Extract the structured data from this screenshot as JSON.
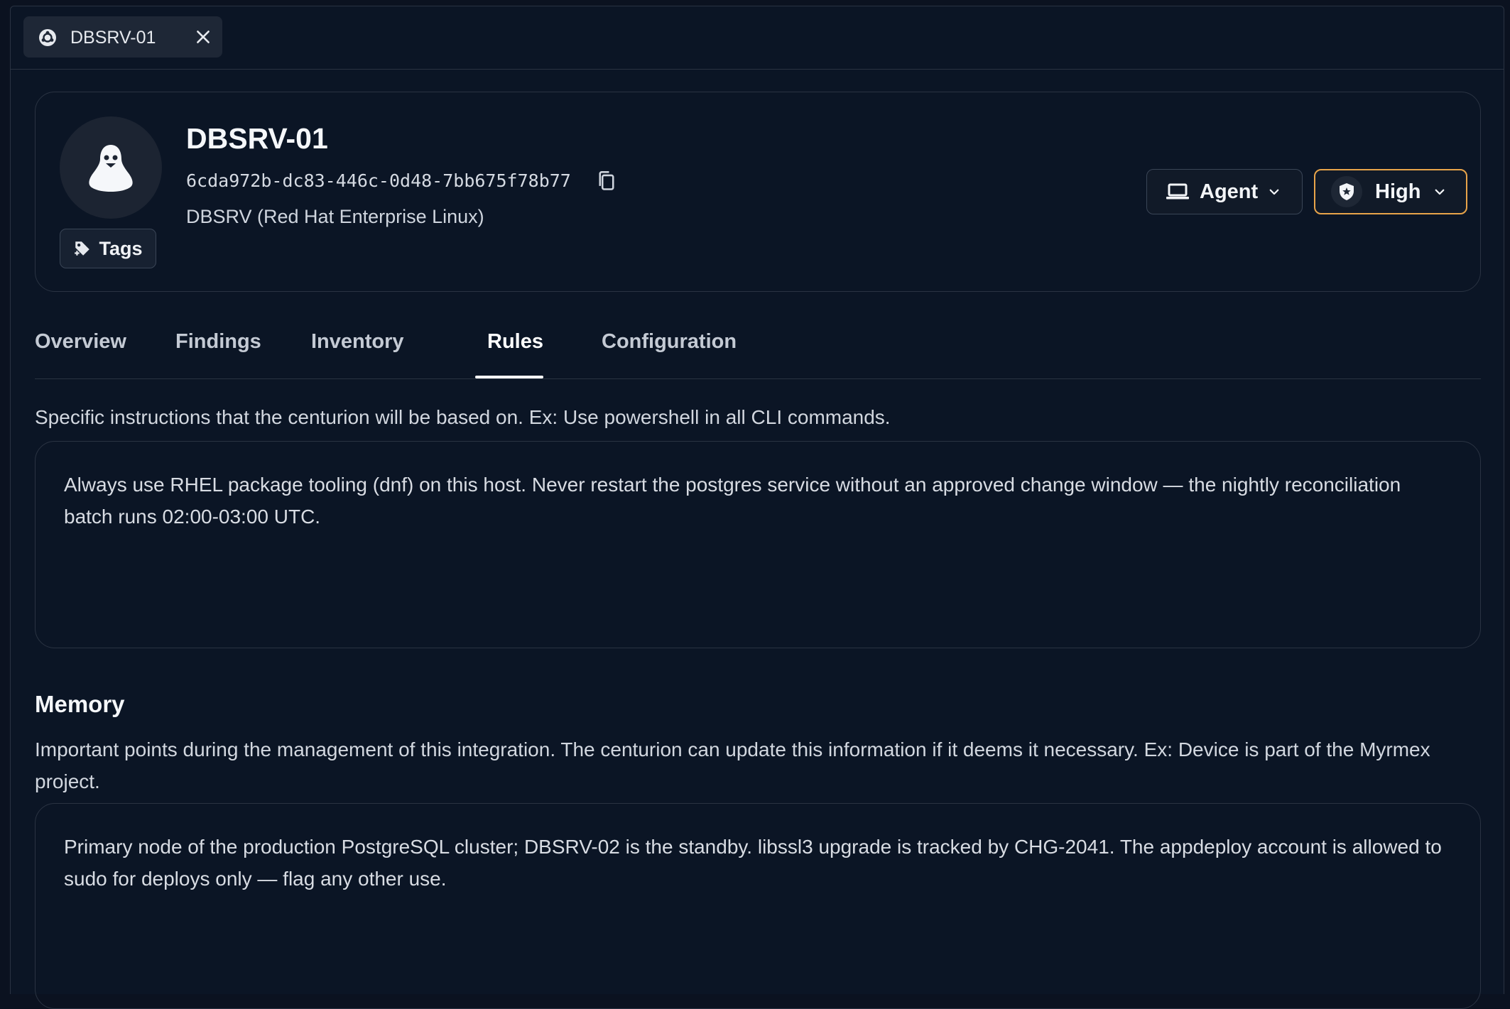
{
  "tab": {
    "title": "DBSRV-01"
  },
  "host": {
    "name": "DBSRV-01",
    "id": "6cda972b-dc83-446c-0d48-7bb675f78b77",
    "os": "DBSRV (Red Hat Enterprise Linux)"
  },
  "buttons": {
    "tags": "Tags",
    "agent": "Agent",
    "priority": "High"
  },
  "colors": {
    "priority_border": "#e8a44a",
    "background": "#0b1525"
  },
  "nav": {
    "tabs": [
      "Overview",
      "Findings",
      "Inventory",
      "Rules",
      "Configuration"
    ],
    "active": "Rules"
  },
  "rules": {
    "description": "Specific instructions that the centurion will be based on. Ex: Use powershell in all CLI commands.",
    "text": "Always use RHEL package tooling (dnf) on this host. Never restart the postgres service without an approved change window — the nightly reconciliation batch runs 02:00-03:00 UTC."
  },
  "memory": {
    "title": "Memory",
    "description": "Important points during the management of this integration. The centurion can update this information if it deems it necessary. Ex: Device is part of the Myrmex project.",
    "text": "Primary node of the production PostgreSQL cluster; DBSRV-02 is the standby. libssl3 upgrade is tracked by CHG-2041. The appdeploy account is allowed to sudo for deploys only — flag any other use."
  },
  "icons": {
    "tab": "ubuntu-icon",
    "close": "close-icon",
    "avatar": "linux-penguin-icon",
    "tags": "tag-icon",
    "copy": "copy-icon",
    "agent": "laptop-icon",
    "priority": "shield-icon",
    "chevron": "chevron-down-icon"
  }
}
